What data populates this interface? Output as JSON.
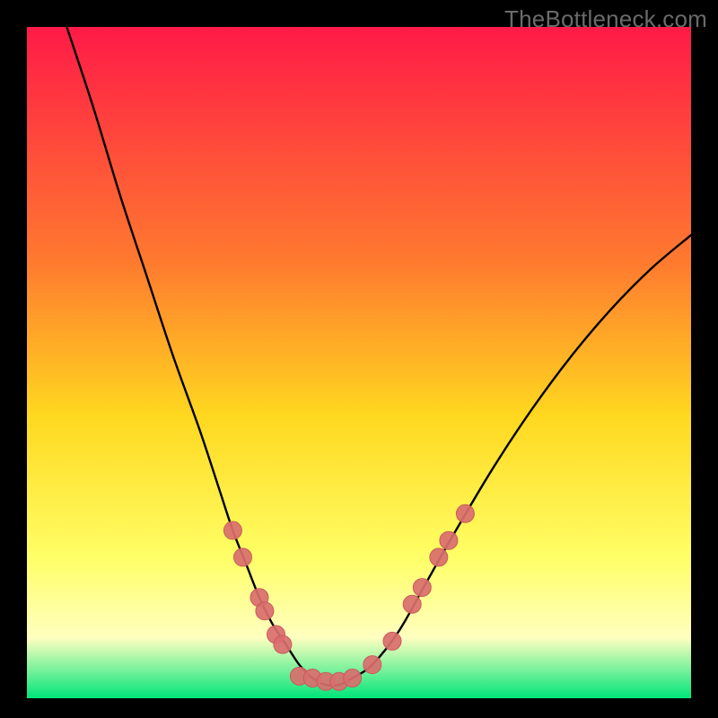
{
  "watermark": "TheBottleneck.com",
  "colors": {
    "gradient_top": "#ff1a47",
    "gradient_mid_upper": "#ff7a2f",
    "gradient_mid": "#ffd81f",
    "gradient_lower": "#ffff66",
    "gradient_light": "#ffffc0",
    "gradient_bottom": "#00e57a",
    "curve": "#000000",
    "marker_fill": "#d96e6e",
    "marker_stroke": "#c95b5b",
    "frame": "#000000"
  },
  "chart_data": {
    "type": "line",
    "title": "",
    "xlabel": "",
    "ylabel": "",
    "xlim": [
      0,
      100
    ],
    "ylim": [
      0,
      100
    ],
    "grid": false,
    "legend": false,
    "series": [
      {
        "name": "bottleneck-curve",
        "x": [
          6,
          10,
          14,
          18,
          22,
          26,
          29,
          31,
          33,
          35,
          37,
          39,
          41,
          43,
          45,
          47,
          49,
          52,
          56,
          60,
          64,
          70,
          76,
          82,
          88,
          94,
          100
        ],
        "y": [
          100,
          88,
          75,
          63,
          51,
          40,
          31,
          25,
          20,
          15,
          11,
          8,
          5,
          3,
          2,
          2,
          3,
          5,
          10,
          17,
          24,
          34,
          43,
          51,
          58,
          64,
          69
        ]
      }
    ],
    "markers": [
      {
        "x": 31,
        "y": 25
      },
      {
        "x": 32.5,
        "y": 21
      },
      {
        "x": 35,
        "y": 15
      },
      {
        "x": 35.8,
        "y": 13
      },
      {
        "x": 37.5,
        "y": 9.5
      },
      {
        "x": 38.5,
        "y": 8
      },
      {
        "x": 41,
        "y": 3.3
      },
      {
        "x": 43,
        "y": 3
      },
      {
        "x": 45,
        "y": 2.5
      },
      {
        "x": 47,
        "y": 2.5
      },
      {
        "x": 49,
        "y": 3
      },
      {
        "x": 52,
        "y": 5
      },
      {
        "x": 55,
        "y": 8.5
      },
      {
        "x": 58,
        "y": 14
      },
      {
        "x": 59.5,
        "y": 16.5
      },
      {
        "x": 62,
        "y": 21
      },
      {
        "x": 63.5,
        "y": 23.5
      },
      {
        "x": 66,
        "y": 27.5
      }
    ],
    "marker_radius_px": 10
  }
}
